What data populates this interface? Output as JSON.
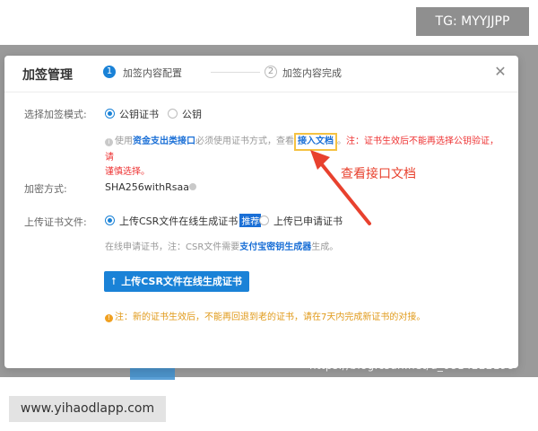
{
  "overlay_badges": {
    "tg": "TG: MYYJJPP",
    "site": "www.yihaodlapp.com",
    "watermark": "https://blog.csdn.net/u_0814222198"
  },
  "modal": {
    "title": "加签管理",
    "steps": [
      {
        "num": "1",
        "label": "加签内容配置",
        "active": true
      },
      {
        "num": "2",
        "label": "加签内容完成",
        "active": false
      }
    ],
    "close_icon": "close-icon"
  },
  "sign_mode": {
    "label": "选择加签模式:",
    "options": [
      {
        "label": "公钥证书",
        "checked": true
      },
      {
        "label": "公钥",
        "checked": false
      }
    ],
    "info": {
      "prefix": "使用",
      "api_link": "资金支出类接口",
      "middle": "必须使用证书方式，查看",
      "doc_link": "接入文档",
      "suffix": "。",
      "warning_line1": "注：证书生效后不能再选择公钥验证，请",
      "warning_line2": "谨慎选择。"
    }
  },
  "encryption": {
    "label": "加密方式:",
    "value": "SHA256withRsaa"
  },
  "upload_cert": {
    "label": "上传证书文件:",
    "options": [
      {
        "label": "上传CSR文件在线生成证书",
        "badge": "推荐",
        "checked": true
      },
      {
        "label": "上传已申请证书",
        "checked": false
      }
    ],
    "note_prefix": "在线申请证书，注：CSR文件需要",
    "note_link": "支付宝密钥生成器",
    "note_suffix": "生成。",
    "button_label": "上传CSR文件在线生成证书",
    "button_icon": "upload-icon"
  },
  "warning_note": "注：新的证书生效后，不能再回退到老的证书，请在7天内完成新证书的对接。",
  "annotation": {
    "text": "查看接口文档",
    "color": "#e8412e"
  },
  "colors": {
    "primary": "#1a82d7",
    "link": "#1a6fd6",
    "highlight_box": "#f5c242",
    "warning_red": "#e33333",
    "warning_orange": "#e09a1a"
  }
}
